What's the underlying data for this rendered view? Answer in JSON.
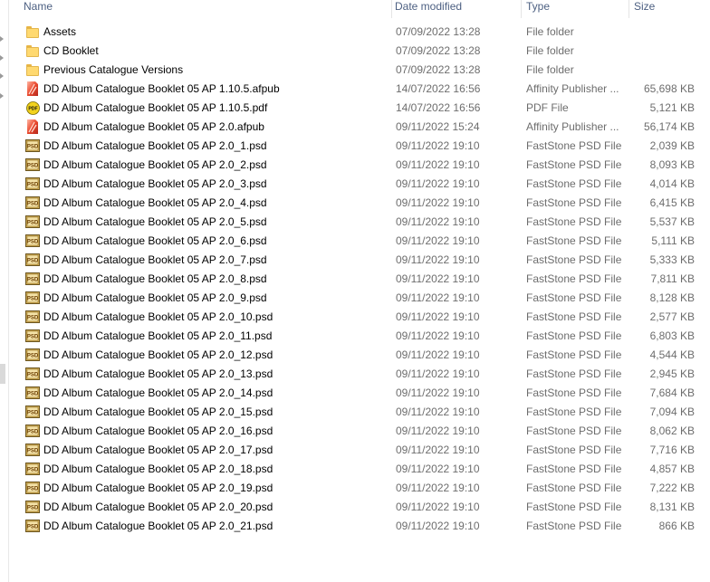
{
  "columns": {
    "name": "Name",
    "date": "Date modified",
    "type": "Type",
    "size": "Size"
  },
  "files": [
    {
      "icon": "folder",
      "name": "Assets",
      "date": "07/09/2022 13:28",
      "type": "File folder",
      "size": ""
    },
    {
      "icon": "folder",
      "name": "CD Booklet",
      "date": "07/09/2022 13:28",
      "type": "File folder",
      "size": ""
    },
    {
      "icon": "folder",
      "name": "Previous Catalogue Versions",
      "date": "07/09/2022 13:28",
      "type": "File folder",
      "size": ""
    },
    {
      "icon": "afpub",
      "name": "DD Album Catalogue Booklet 05 AP 1.10.5.afpub",
      "date": "14/07/2022 16:56",
      "type": "Affinity Publisher ...",
      "size": "65,698 KB"
    },
    {
      "icon": "pdf",
      "name": "DD Album Catalogue Booklet 05 AP 1.10.5.pdf",
      "date": "14/07/2022 16:56",
      "type": "PDF File",
      "size": "5,121 KB"
    },
    {
      "icon": "afpub",
      "name": "DD Album Catalogue Booklet 05 AP 2.0.afpub",
      "date": "09/11/2022 15:24",
      "type": "Affinity Publisher ...",
      "size": "56,174 KB"
    },
    {
      "icon": "psd",
      "name": "DD Album Catalogue Booklet 05 AP 2.0_1.psd",
      "date": "09/11/2022 19:10",
      "type": "FastStone PSD File",
      "size": "2,039 KB"
    },
    {
      "icon": "psd",
      "name": "DD Album Catalogue Booklet 05 AP 2.0_2.psd",
      "date": "09/11/2022 19:10",
      "type": "FastStone PSD File",
      "size": "8,093 KB"
    },
    {
      "icon": "psd",
      "name": "DD Album Catalogue Booklet 05 AP 2.0_3.psd",
      "date": "09/11/2022 19:10",
      "type": "FastStone PSD File",
      "size": "4,014 KB"
    },
    {
      "icon": "psd",
      "name": "DD Album Catalogue Booklet 05 AP 2.0_4.psd",
      "date": "09/11/2022 19:10",
      "type": "FastStone PSD File",
      "size": "6,415 KB"
    },
    {
      "icon": "psd",
      "name": "DD Album Catalogue Booklet 05 AP 2.0_5.psd",
      "date": "09/11/2022 19:10",
      "type": "FastStone PSD File",
      "size": "5,537 KB"
    },
    {
      "icon": "psd",
      "name": "DD Album Catalogue Booklet 05 AP 2.0_6.psd",
      "date": "09/11/2022 19:10",
      "type": "FastStone PSD File",
      "size": "5,111 KB"
    },
    {
      "icon": "psd",
      "name": "DD Album Catalogue Booklet 05 AP 2.0_7.psd",
      "date": "09/11/2022 19:10",
      "type": "FastStone PSD File",
      "size": "5,333 KB"
    },
    {
      "icon": "psd",
      "name": "DD Album Catalogue Booklet 05 AP 2.0_8.psd",
      "date": "09/11/2022 19:10",
      "type": "FastStone PSD File",
      "size": "7,811 KB"
    },
    {
      "icon": "psd",
      "name": "DD Album Catalogue Booklet 05 AP 2.0_9.psd",
      "date": "09/11/2022 19:10",
      "type": "FastStone PSD File",
      "size": "8,128 KB"
    },
    {
      "icon": "psd",
      "name": "DD Album Catalogue Booklet 05 AP 2.0_10.psd",
      "date": "09/11/2022 19:10",
      "type": "FastStone PSD File",
      "size": "2,577 KB"
    },
    {
      "icon": "psd",
      "name": "DD Album Catalogue Booklet 05 AP 2.0_11.psd",
      "date": "09/11/2022 19:10",
      "type": "FastStone PSD File",
      "size": "6,803 KB"
    },
    {
      "icon": "psd",
      "name": "DD Album Catalogue Booklet 05 AP 2.0_12.psd",
      "date": "09/11/2022 19:10",
      "type": "FastStone PSD File",
      "size": "4,544 KB"
    },
    {
      "icon": "psd",
      "name": "DD Album Catalogue Booklet 05 AP 2.0_13.psd",
      "date": "09/11/2022 19:10",
      "type": "FastStone PSD File",
      "size": "2,945 KB"
    },
    {
      "icon": "psd",
      "name": "DD Album Catalogue Booklet 05 AP 2.0_14.psd",
      "date": "09/11/2022 19:10",
      "type": "FastStone PSD File",
      "size": "7,684 KB"
    },
    {
      "icon": "psd",
      "name": "DD Album Catalogue Booklet 05 AP 2.0_15.psd",
      "date": "09/11/2022 19:10",
      "type": "FastStone PSD File",
      "size": "7,094 KB"
    },
    {
      "icon": "psd",
      "name": "DD Album Catalogue Booklet 05 AP 2.0_16.psd",
      "date": "09/11/2022 19:10",
      "type": "FastStone PSD File",
      "size": "8,062 KB"
    },
    {
      "icon": "psd",
      "name": "DD Album Catalogue Booklet 05 AP 2.0_17.psd",
      "date": "09/11/2022 19:10",
      "type": "FastStone PSD File",
      "size": "7,716 KB"
    },
    {
      "icon": "psd",
      "name": "DD Album Catalogue Booklet 05 AP 2.0_18.psd",
      "date": "09/11/2022 19:10",
      "type": "FastStone PSD File",
      "size": "4,857 KB"
    },
    {
      "icon": "psd",
      "name": "DD Album Catalogue Booklet 05 AP 2.0_19.psd",
      "date": "09/11/2022 19:10",
      "type": "FastStone PSD File",
      "size": "7,222 KB"
    },
    {
      "icon": "psd",
      "name": "DD Album Catalogue Booklet 05 AP 2.0_20.psd",
      "date": "09/11/2022 19:10",
      "type": "FastStone PSD File",
      "size": "8,131 KB"
    },
    {
      "icon": "psd",
      "name": "DD Album Catalogue Booklet 05 AP 2.0_21.psd",
      "date": "09/11/2022 19:10",
      "type": "FastStone PSD File",
      "size": "866 KB"
    }
  ],
  "icon_names": {
    "folder": "folder-icon",
    "afpub": "affinity-publisher-icon",
    "pdf": "pdf-icon",
    "psd": "psd-file-icon"
  },
  "colors": {
    "header_text": "#4d6082",
    "secondary_text": "#6d6d6d",
    "folder": "#ffd970"
  }
}
